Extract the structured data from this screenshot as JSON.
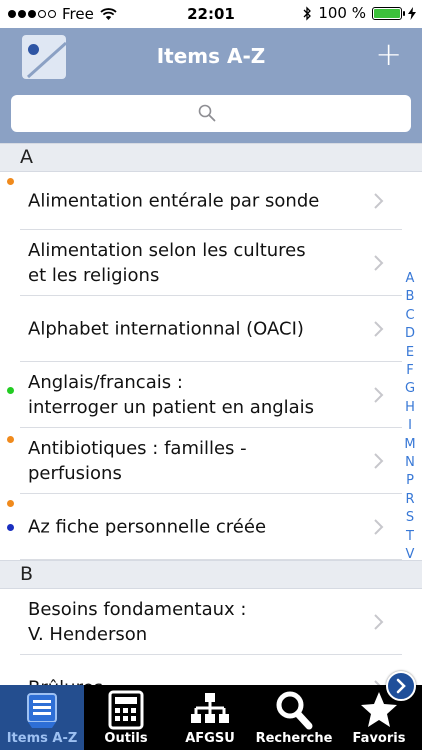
{
  "status": {
    "carrier": "Free",
    "time": "22:01",
    "battery": "100 %",
    "battery_level": 1.0
  },
  "nav": {
    "title": "Items A-Z",
    "add_label": "+"
  },
  "search": {
    "placeholder": ""
  },
  "sections": [
    {
      "header": "A",
      "items": [
        {
          "label": "Alimentation entérale par sonde",
          "marks": [
            "#f08a1c"
          ]
        },
        {
          "label": "Alimentation selon les cultures\net les religions",
          "marks": []
        },
        {
          "label": "Alphabet internationnal (OACI)",
          "marks": []
        },
        {
          "label": "Anglais/francais :\ninterroger un patient en anglais",
          "marks": [
            "#22cc22"
          ]
        },
        {
          "label": "Antibiotiques : familles -\nperfusions",
          "marks": [
            "#f08a1c"
          ]
        },
        {
          "label": "Az fiche personnelle créée",
          "marks": [
            "#f08a1c",
            "#1a2fc0"
          ]
        }
      ]
    },
    {
      "header": "B",
      "items": [
        {
          "label": "Besoins fondamentaux :\nV. Henderson",
          "marks": []
        },
        {
          "label": "Brûlures",
          "marks": []
        }
      ]
    }
  ],
  "index_letters": [
    "A",
    "B",
    "C",
    "D",
    "E",
    "F",
    "G",
    "H",
    "I",
    "M",
    "N",
    "P",
    "R",
    "S",
    "T",
    "V"
  ],
  "tabs": [
    {
      "label": "Items A-Z",
      "icon": "list-box-icon",
      "active": true
    },
    {
      "label": "Outils",
      "icon": "calculator-icon",
      "active": false
    },
    {
      "label": "AFGSU",
      "icon": "hierarchy-icon",
      "active": false
    },
    {
      "label": "Recherche",
      "icon": "magnifier-icon",
      "active": false
    },
    {
      "label": "Favoris",
      "icon": "star-icon",
      "active": false
    }
  ],
  "colors": {
    "nav_background": "#8ba1c4",
    "index_accent": "#3878d6",
    "active_tab": "#244e8f"
  }
}
